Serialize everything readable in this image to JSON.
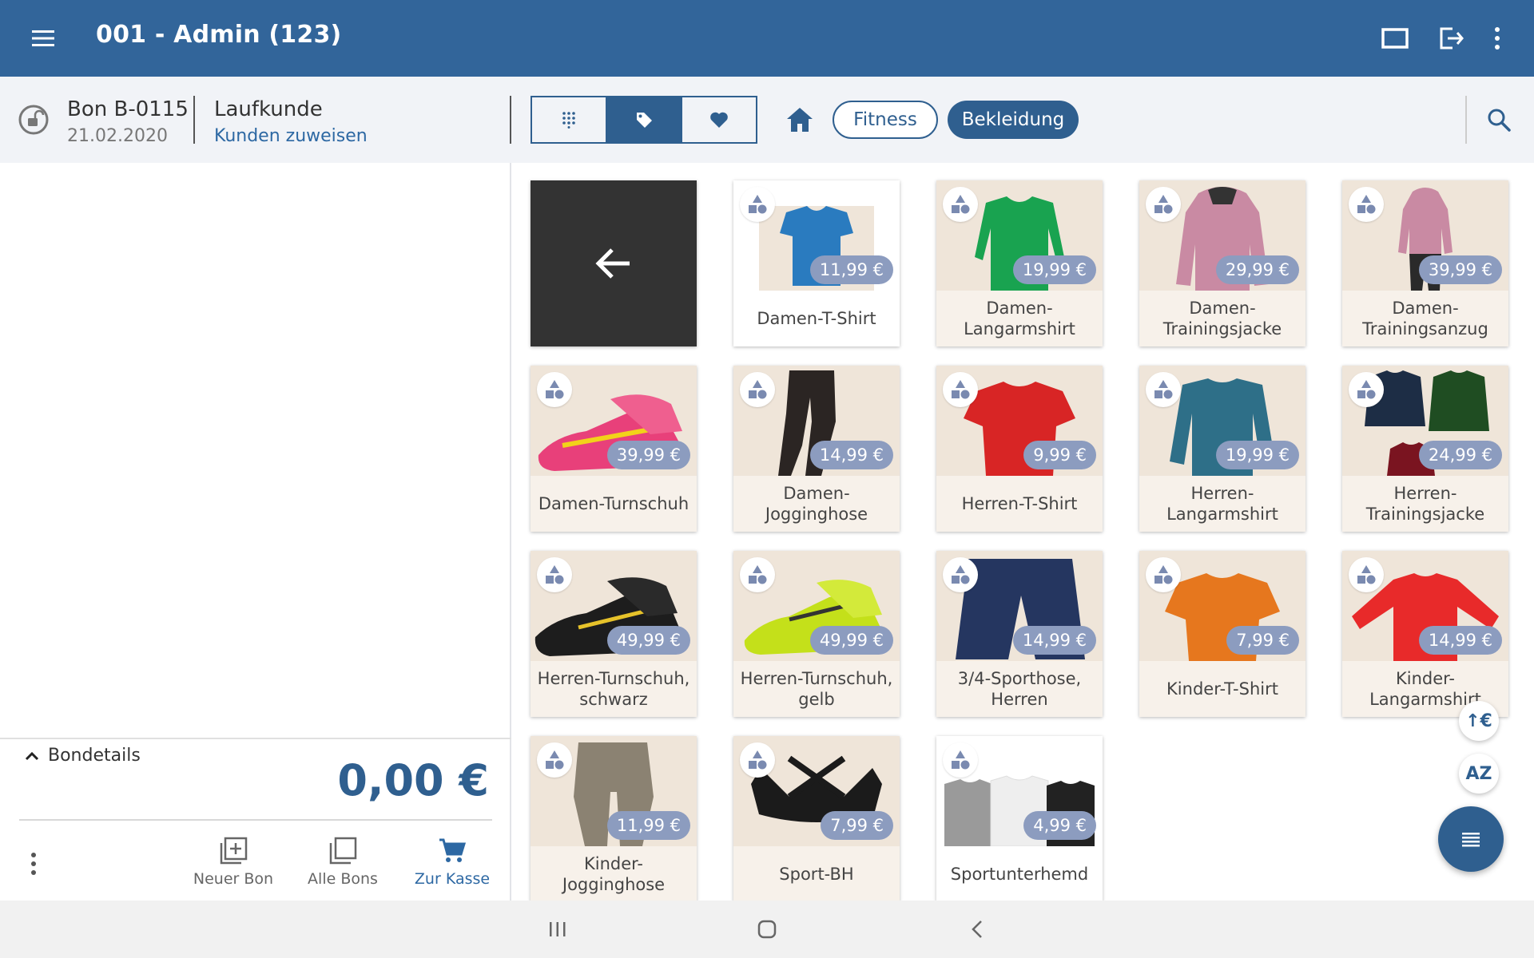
{
  "appbar": {
    "title": "001 - Admin (123)",
    "icons": [
      "menu-icon",
      "display-icon",
      "logout-icon",
      "more-vert-icon"
    ]
  },
  "receipt": {
    "number": "Bon B-0115",
    "date": "21.02.2020",
    "customer": "Laufkunde",
    "assign_link": "Kunden zuweisen"
  },
  "view_tabs": [
    {
      "icon": "keypad-icon",
      "active": false
    },
    {
      "icon": "tag-icon",
      "active": true
    },
    {
      "icon": "heart-icon",
      "active": false
    }
  ],
  "breadcrumb": {
    "home_icon": "home-icon",
    "chips": [
      {
        "label": "Fitness",
        "selected": false
      },
      {
        "label": "Bekleidung",
        "selected": true
      }
    ]
  },
  "bondetails": {
    "label": "Bondetails",
    "total": "0,00 €"
  },
  "actions": {
    "new": "Neuer Bon",
    "all": "Alle Bons",
    "checkout": "Zur Kasse"
  },
  "sort_buttons": {
    "price": "↑€",
    "alpha": "AZ"
  },
  "products": [
    {
      "name": "Damen-T-Shirt",
      "price": "11,99 €"
    },
    {
      "name": "Damen-Langarmshirt",
      "price": "19,99 €"
    },
    {
      "name": "Damen-Trainingsjacke",
      "price": "29,99 €"
    },
    {
      "name": "Damen-Trainingsanzug",
      "price": "39,99 €"
    },
    {
      "name": "Damen-Turnschuh",
      "price": "39,99 €"
    },
    {
      "name": "Damen-Jogginghose",
      "price": "14,99 €"
    },
    {
      "name": "Herren-T-Shirt",
      "price": "9,99 €"
    },
    {
      "name": "Herren-Langarmshirt",
      "price": "19,99 €"
    },
    {
      "name": "Herren-Trainingsjacke",
      "price": "24,99 €"
    },
    {
      "name": "Herren-Turnschuh, schwarz",
      "price": "49,99 €"
    },
    {
      "name": "Herren-Turnschuh, gelb",
      "price": "49,99 €"
    },
    {
      "name": "3/4-Sporthose, Herren",
      "price": "14,99 €"
    },
    {
      "name": "Kinder-T-Shirt",
      "price": "7,99 €"
    },
    {
      "name": "Kinder-Langarmshirt",
      "price": "14,99 €"
    },
    {
      "name": "Kinder-Jogginghose",
      "price": "11,99 €"
    },
    {
      "name": "Sport-BH",
      "price": "7,99 €"
    },
    {
      "name": "Sportunterhemd",
      "price": "4,99 €"
    }
  ],
  "colors": {
    "primary": "#32659a",
    "accent": "#2f5f8f",
    "price_badge": "#8c9cbf"
  }
}
